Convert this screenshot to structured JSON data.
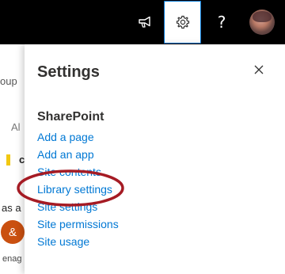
{
  "topbar": {
    "icons": {
      "feedback": "megaphone-icon",
      "settings": "gear-icon",
      "help": "help-icon"
    },
    "help_label": "?",
    "background": "#000000"
  },
  "background_page": {
    "fragments": [
      "oup",
      "Al",
      "c",
      "as a",
      "enag"
    ],
    "avatar_letter": "&",
    "accent_colors": {
      "yellow_bar": "#f2c811",
      "circle": "#ca5010"
    }
  },
  "settings_panel": {
    "title": "Settings",
    "close_icon": "close-icon",
    "section": {
      "title": "SharePoint",
      "links": [
        "Add a page",
        "Add an app",
        "Site contents",
        "Library settings",
        "Site settings",
        "Site permissions",
        "Site usage"
      ]
    },
    "highlighted_link": "Library settings",
    "highlight_color": "#a51b24",
    "link_color": "#0078d4"
  }
}
